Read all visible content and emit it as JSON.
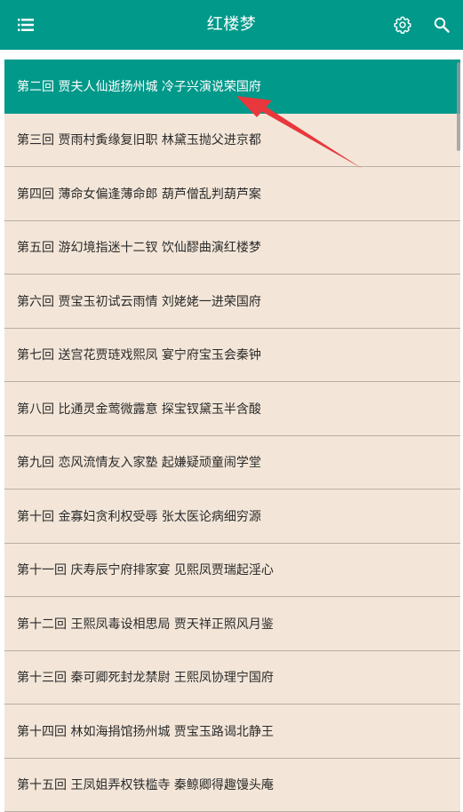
{
  "header": {
    "title": "红楼梦",
    "icons": {
      "menu": "menu-icon",
      "settings": "gear-icon",
      "search": "search-icon"
    }
  },
  "colors": {
    "primary": "#00998a",
    "row_background": "#f3e6d8",
    "row_divider": "#b9aea4",
    "annotation_arrow": "#e8383d"
  },
  "chapters": [
    {
      "label": "第二回 贾夫人仙逝扬州城 冷子兴演说荣国府",
      "selected": true
    },
    {
      "label": "第三回 贾雨村夤缘复旧职 林黛玉抛父进京都"
    },
    {
      "label": "第四回 薄命女偏逢薄命郎 葫芦僧乱判葫芦案"
    },
    {
      "label": "第五回 游幻境指迷十二钗 饮仙醪曲演红楼梦"
    },
    {
      "label": "第六回 贾宝玉初试云雨情 刘姥姥一进荣国府"
    },
    {
      "label": "第七回 送宫花贾琏戏熙凤 宴宁府宝玉会秦钟"
    },
    {
      "label": "第八回 比通灵金莺微露意 探宝钗黛玉半含酸"
    },
    {
      "label": "第九回 恋风流情友入家塾 起嫌疑顽童闹学堂"
    },
    {
      "label": "第十回 金寡妇贪利权受辱 张太医论病细穷源"
    },
    {
      "label": "第十一回 庆寿辰宁府排家宴 见熙凤贾瑞起淫心"
    },
    {
      "label": "第十二回 王熙凤毒设相思局 贾天祥正照风月鉴"
    },
    {
      "label": "第十三回 秦可卿死封龙禁尉 王熙凤协理宁国府"
    },
    {
      "label": "第十四回 林如海捐馆扬州城 贾宝玉路谒北静王"
    },
    {
      "label": "第十五回 王凤姐弄权铁槛寺 秦鲸卿得趣馒头庵"
    }
  ]
}
